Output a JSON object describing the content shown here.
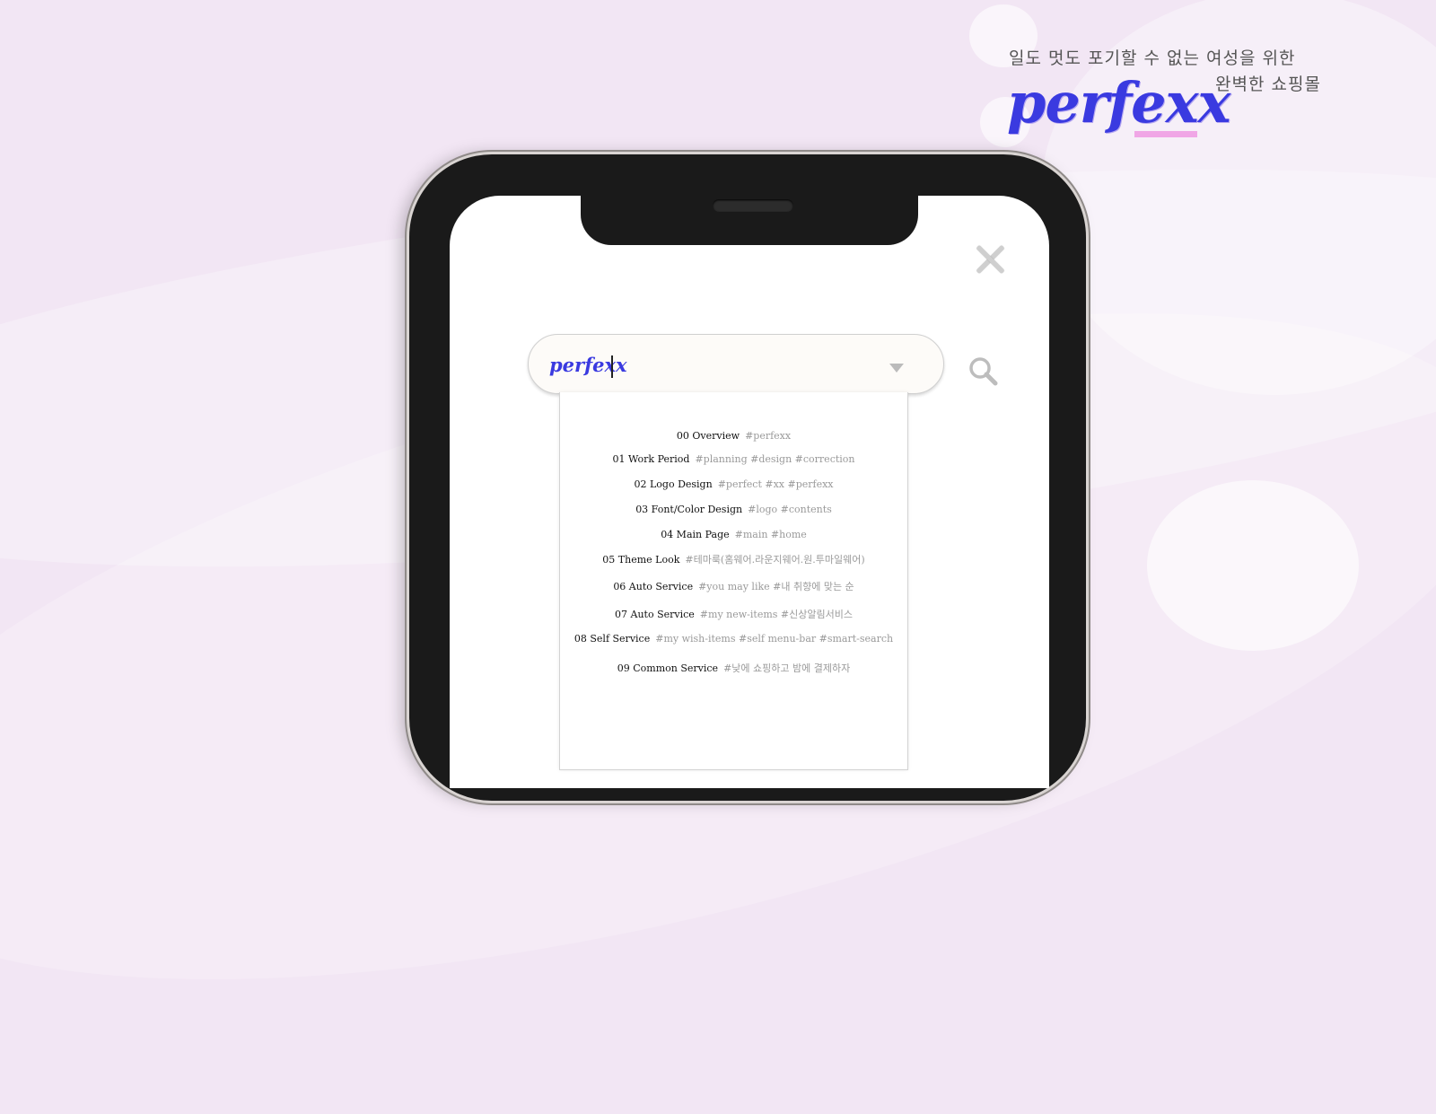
{
  "header": {
    "tagline_line1": "일도 멋도 포기할 수 없는 여성을 위한",
    "tagline_line2": "완벽한 쇼핑몰",
    "brand": "perfexx"
  },
  "search": {
    "value": "perfexx"
  },
  "results": [
    {
      "title": "00 Overview",
      "tags": "#perfexx"
    },
    {
      "title": "01 Work Period",
      "tags": "#planning #design  #correction"
    },
    {
      "title": "02 Logo Design",
      "tags": "#perfect #xx #perfexx"
    },
    {
      "title": "03 Font/Color Design",
      "tags": "#logo #contents"
    },
    {
      "title": "04 Main Page",
      "tags": "#main #home"
    },
    {
      "title": "05 Theme Look",
      "tags": "#테마룩(홈웨어.라운지웨어.원.투마일웨어)"
    },
    {
      "title": "06 Auto Service",
      "tags": "#you may like  #내 취향에 맞는 순"
    },
    {
      "title": "07 Auto Service",
      "tags": "#my new-items #신상알림서비스"
    },
    {
      "title": "08 Self Service",
      "tags": "#my wish-items #self menu-bar #smart-search"
    },
    {
      "title": "09 Common Service",
      "tags": "#낮에 쇼핑하고 밤에 결제하자"
    }
  ],
  "colors": {
    "background": "#f2e6f4",
    "brand": "#3a3ae0",
    "brand_underline": "#f0a6e6"
  },
  "icons": [
    "close-icon",
    "search-icon",
    "chevron-down-icon"
  ]
}
